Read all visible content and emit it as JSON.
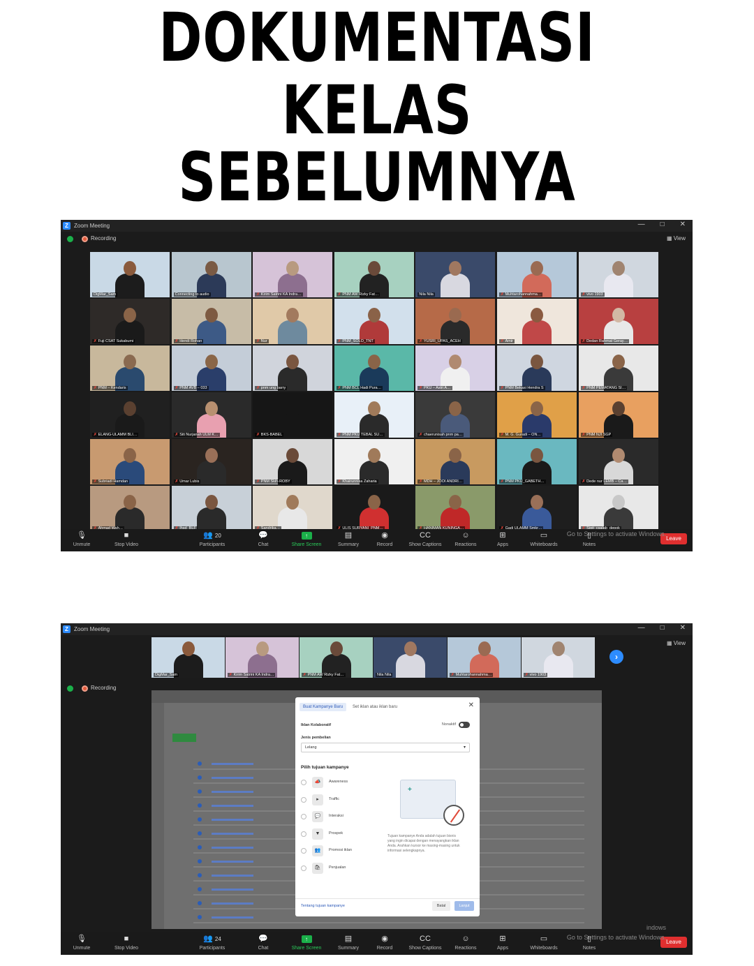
{
  "heading": {
    "line1": "DOKUMENTASI",
    "line2": "KELAS SEBELUMNYA"
  },
  "window": {
    "title": "Zoom Meeting",
    "recording_label": "Recording",
    "view_label": "View",
    "minimize": "—",
    "maximize": "□",
    "close": "✕"
  },
  "shot1": {
    "participants": [
      {
        "name": "DigMar_Sam",
        "bg": "#c9d9e6",
        "skin": "#8a5a3c",
        "shirt": "#1c1c1c",
        "muted": false
      },
      {
        "name": "Connecting to audio",
        "bg": "#b8c6cf",
        "skin": "#7a5a44",
        "shirt": "#2c3a58",
        "muted": false
      },
      {
        "name": "Kirim Satrini KA Indra…",
        "bg": "#d6c3d8",
        "skin": "#b89a80",
        "shirt": "#8d6f8f",
        "muted": true
      },
      {
        "name": "PNM AW Rizky Fat…",
        "bg": "#a7d1c0",
        "skin": "#6a4a3a",
        "shirt": "#222222",
        "muted": true
      },
      {
        "name": "Nila Nila",
        "bg": "#3a4a6a",
        "skin": "#a07860",
        "shirt": "#d8d8e0",
        "muted": false
      },
      {
        "name": "Muhtarohannahma…",
        "bg": "#b5c8d9",
        "skin": "#9a6a52",
        "shirt": "#d26a5a",
        "muted": true
      },
      {
        "name": "vivo 1903",
        "bg": "#d0d7df",
        "skin": "#a08470",
        "shirt": "#e8e8f0",
        "muted": true
      },
      {
        "name": "Fuji CSAT Sukabumi",
        "bg": "#2e2a28",
        "skin": "#8a6448",
        "shirt": "#1a1a1a",
        "muted": true
      },
      {
        "name": "Hendi Rohan",
        "bg": "#c7bca7",
        "skin": "#7d5a42",
        "shirt": "#3d5a86",
        "muted": true
      },
      {
        "name": "Nur",
        "bg": "#e0c9a8",
        "skin": "#a27a5e",
        "shirt": "#6e8a9e",
        "muted": true
      },
      {
        "name": "PNM_SOLO_TNT",
        "bg": "#d2e0ec",
        "skin": "#8a6248",
        "shirt": "#b03a3a",
        "muted": true
      },
      {
        "name": "YUSRI_UPAS_ACEH",
        "bg": "#b66a48",
        "skin": "#9a6a50",
        "shirt": "#2a2a2a",
        "muted": true
      },
      {
        "name": "Amir",
        "bg": "#efe6dc",
        "skin": "#8a5a40",
        "shirt": "#c04848",
        "muted": true
      },
      {
        "name": "Dedan Rahmat Geray…",
        "bg": "#b84040",
        "skin": "#d2b8a4",
        "shirt": "#e8e8e8",
        "muted": true
      },
      {
        "name": "PNM – Kendaris",
        "bg": "#c8b89c",
        "skin": "#8a6a50",
        "shirt": "#2a4a6e",
        "muted": true
      },
      {
        "name": "PNM AVB – 033",
        "bg": "#c4cdd8",
        "skin": "#8a6648",
        "shirt": "#2a3e6a",
        "muted": true
      },
      {
        "name": "pnm ung barry",
        "bg": "#d0d4dc",
        "skin": "#7a5640",
        "shirt": "#2a2a2a",
        "muted": true
      },
      {
        "name": "PNM BCL Hadi Pura…",
        "bg": "#5ab8a8",
        "skin": "#8a6448",
        "shirt": "#1a3a5a",
        "muted": true
      },
      {
        "name": "PKU – Astri A…",
        "bg": "#d8d0e6",
        "skin": "#b08a70",
        "shirt": "#f0f0f0",
        "muted": true
      },
      {
        "name": "PNM Bekasi Hendra S",
        "bg": "#cfd6e0",
        "skin": "#7a5640",
        "shirt": "#2a3a5a",
        "muted": true
      },
      {
        "name": "PNM PEMATANG SI…",
        "bg": "#e8e8e8",
        "skin": "#8a6448",
        "shirt": "#3a3a3a",
        "muted": true
      },
      {
        "name": "ELANG-ULAMM BLI…",
        "bg": "#202020",
        "skin": "#5a4030",
        "shirt": "#1a1a1a",
        "muted": true
      },
      {
        "name": "Siti Nurjanah ULM K…",
        "bg": "#2a2a2a",
        "skin": "#b89070",
        "shirt": "#e8a0b0",
        "muted": true
      },
      {
        "name": "BKS-BABEL",
        "bg": "#161616",
        "skin": "#161616",
        "shirt": "#161616",
        "muted": true
      },
      {
        "name": "PNM PKU TEBAL SU…",
        "bg": "#e8f0f8",
        "skin": "#a07a5a",
        "shirt": "#2a2a2a",
        "muted": true
      },
      {
        "name": "chaerunisah pnm pa…",
        "bg": "#3a3a3a",
        "skin": "#8a6448",
        "shirt": "#4a5a7a",
        "muted": true
      },
      {
        "name": "M. G. Guradi – ON…",
        "bg": "#e0a048",
        "skin": "#8a6448",
        "shirt": "#2a3a6a",
        "muted": true
      },
      {
        "name": "PNM NJI SGP",
        "bg": "#e8a060",
        "skin": "#5a4030",
        "shirt": "#1a1a1a",
        "muted": true
      },
      {
        "name": "Subriadi Hamdan",
        "bg": "#c89a70",
        "skin": "#8a6448",
        "shirt": "#2a4a7a",
        "muted": true
      },
      {
        "name": "Umar Lubis",
        "bg": "#2a2420",
        "skin": "#9a7058",
        "shirt": "#2a2a2a",
        "muted": true
      },
      {
        "name": "PNM Skih-ROBY",
        "bg": "#d8d8d8",
        "skin": "#6a4a38",
        "shirt": "#1a1a1a",
        "muted": true
      },
      {
        "name": "Khairunnisa Zaharia",
        "bg": "#f0f0f0",
        "skin": "#a07a5a",
        "shirt": "#2a2a2a",
        "muted": true
      },
      {
        "name": "MDH – JOOI ANDRI…",
        "bg": "#c89a60",
        "skin": "#8a6448",
        "shirt": "#2a3a5a",
        "muted": true
      },
      {
        "name": "PNM PKU_GABETH…",
        "bg": "#6ab8c0",
        "skin": "#7a5640",
        "shirt": "#1a1a1a",
        "muted": true
      },
      {
        "name": "Dede nur LEMB – Ca…",
        "bg": "#2a2a2a",
        "skin": "#b08a70",
        "shirt": "#d8d8d8",
        "muted": true
      },
      {
        "name": "Ahmad Wah…",
        "bg": "#b89a80",
        "skin": "#8a6448",
        "shirt": "#2a2a2a",
        "muted": true
      },
      {
        "name": "Ihsd_BLF",
        "bg": "#c8d0d8",
        "skin": "#7a5640",
        "shirt": "#2a2a2a",
        "muted": true
      },
      {
        "name": "Sandrika…",
        "bg": "#e0d8cc",
        "skin": "#a07a5a",
        "shirt": "#e8e8e8",
        "muted": true
      },
      {
        "name": "ULIS SURYANI_PNM…",
        "bg": "#1a1a1a",
        "skin": "#8a6448",
        "shirt": "#d03030",
        "muted": true
      },
      {
        "name": "HANIMAN KUNINGA…",
        "bg": "#8a9a6a",
        "skin": "#8a6448",
        "shirt": "#c02828",
        "muted": true
      },
      {
        "name": "Gadi ULAMM Smkr…",
        "bg": "#1e1e1e",
        "skin": "#9a7058",
        "shirt": "#3a5a9a",
        "muted": true
      },
      {
        "name": "Sigit_csalab_depok",
        "bg": "#e8e8e8",
        "skin": "#c8c8c8",
        "shirt": "#3a3a3a",
        "muted": true
      }
    ],
    "participants_count": "20"
  },
  "toolbar": {
    "unmute": "Unmute",
    "stop_video": "Stop Video",
    "participants": "Participants",
    "chat": "Chat",
    "share_screen": "Share Screen",
    "summary": "Summary",
    "record": "Record",
    "show_captions": "Show Captions",
    "reactions": "Reactions",
    "apps": "Apps",
    "whiteboards": "Whiteboards",
    "notes": "Notes",
    "leave": "Leave",
    "watermark1": "Go to Settings to activate Windows.",
    "watermark2a": "indows",
    "watermark2b": "Go to Settings to activate Windows."
  },
  "shot2": {
    "strip": [
      {
        "name": "DigMar_Sam",
        "bg": "#c9d9e6",
        "skin": "#8a5a3c",
        "shirt": "#1c1c1c",
        "muted": false
      },
      {
        "name": "Kirim Satrini KA Indra…",
        "bg": "#d6c3d8",
        "skin": "#b89a80",
        "shirt": "#8d6f8f",
        "muted": true
      },
      {
        "name": "PNM AW Rizky Fat…",
        "bg": "#a7d1c0",
        "skin": "#6a4a3a",
        "shirt": "#222222",
        "muted": true
      },
      {
        "name": "Nila Nila",
        "bg": "#3a4a6a",
        "skin": "#a07860",
        "shirt": "#d8d8e0",
        "muted": false
      },
      {
        "name": "Muhtarohannahma…",
        "bg": "#b5c8d9",
        "skin": "#9a6a52",
        "shirt": "#d26a5a",
        "muted": true
      },
      {
        "name": "vivo 1903",
        "bg": "#d0d7df",
        "skin": "#a08470",
        "shirt": "#e8e8f0",
        "muted": true
      }
    ],
    "participants_count": "24",
    "dialog": {
      "tab_active": "Buat Kampanye Baru",
      "tab_other": "Set iklan atau iklan baru",
      "label_collab": "Iklan Kolaboratif",
      "toggle_label": "Nonaktif",
      "label_purchase": "Jenis pembelian",
      "purchase_value": "Lelang",
      "heading_objective": "Pilih tujuan kampanye",
      "objectives": [
        {
          "icon": "📣",
          "label": "Awareness"
        },
        {
          "icon": "▸",
          "label": "Traffic"
        },
        {
          "icon": "💬",
          "label": "Interaksi"
        },
        {
          "icon": "▼",
          "label": "Prospek"
        },
        {
          "icon": "👥",
          "label": "Promosi iklan"
        },
        {
          "icon": "🛍",
          "label": "Penjualan"
        }
      ],
      "description": "Tujuan kampanye Anda adalah tujuan bisnis yang ingin dicapai dengan menayangkan iklan Anda. Arahkan kursor ke masing-masing untuk informasi selengkapnya.",
      "footer_link": "Tentang tujuan kampanye",
      "cancel": "Batal",
      "next": "Lanjut"
    }
  }
}
